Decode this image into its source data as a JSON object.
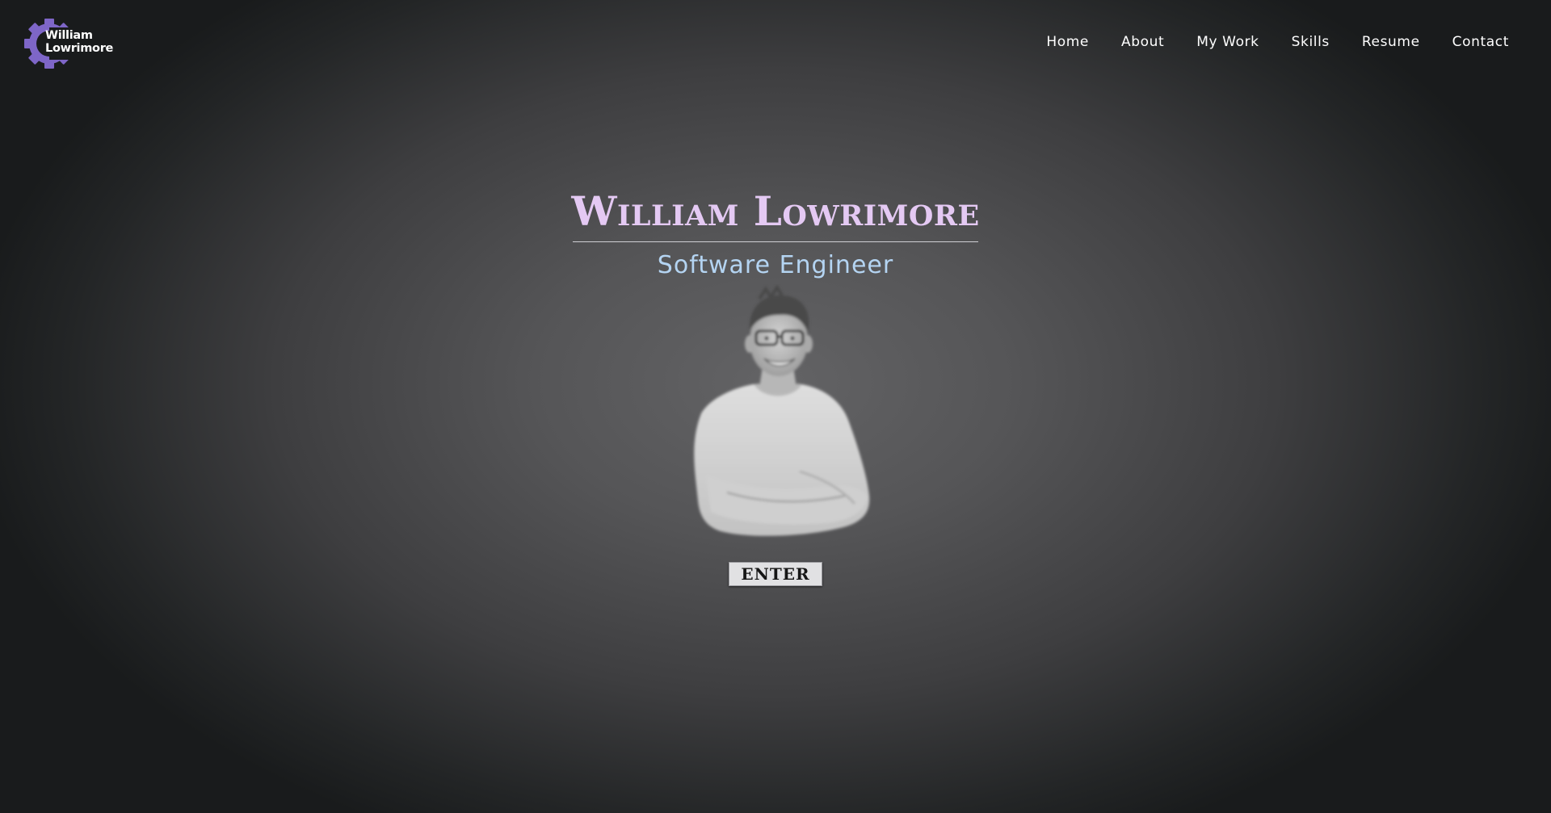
{
  "logo": {
    "line1": "William",
    "line2": "Lowrimore",
    "icon": "gear-icon",
    "accent_color": "#7e66c7"
  },
  "nav": {
    "items": [
      {
        "label": "Home"
      },
      {
        "label": "About"
      },
      {
        "label": "My Work"
      },
      {
        "label": "Skills"
      },
      {
        "label": "Resume"
      },
      {
        "label": "Contact"
      }
    ]
  },
  "hero": {
    "title": "William Lowrimore",
    "subtitle": "Software Engineer",
    "title_color": "#e4c9f3",
    "subtitle_color": "#b4d4f2",
    "photo": "grayscale-portrait-man-arms-crossed",
    "button_label": "ENTER"
  }
}
